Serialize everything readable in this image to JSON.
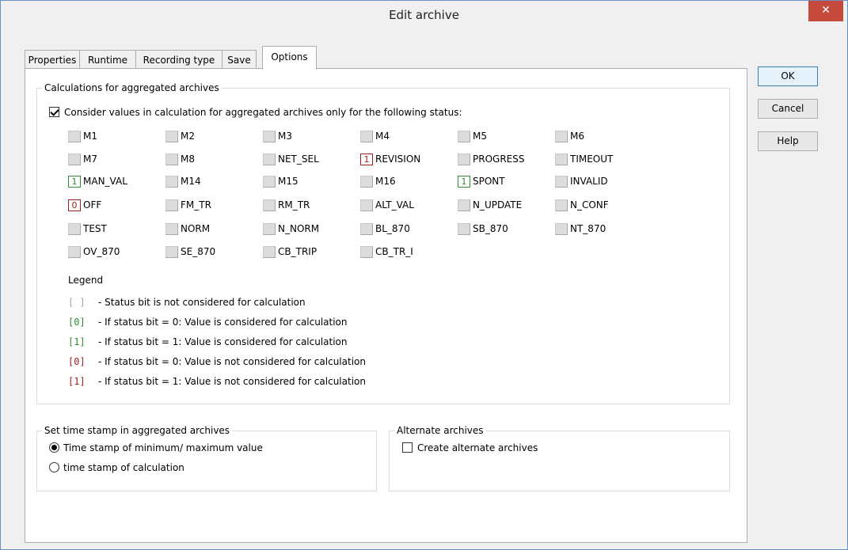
{
  "window": {
    "title": "Edit archive",
    "close_glyph": "✕"
  },
  "tabs": [
    {
      "label": "Properties"
    },
    {
      "label": "Runtime"
    },
    {
      "label": "Recording type"
    },
    {
      "label": "Save"
    },
    {
      "label": "Options",
      "active": true
    }
  ],
  "buttons": {
    "ok": "OK",
    "cancel": "Cancel",
    "help": "Help"
  },
  "calc_group": {
    "title": "Calculations for aggregated archives",
    "consider_checkbox": {
      "label": "Consider values in calculation for aggregated archives only for the following status:",
      "checked": true
    }
  },
  "statuses": [
    {
      "label": "M1",
      "state": "none",
      "value": ""
    },
    {
      "label": "M2",
      "state": "none",
      "value": ""
    },
    {
      "label": "M3",
      "state": "none",
      "value": ""
    },
    {
      "label": "M4",
      "state": "none",
      "value": ""
    },
    {
      "label": "M5",
      "state": "none",
      "value": ""
    },
    {
      "label": "M6",
      "state": "none",
      "value": ""
    },
    {
      "label": "M7",
      "state": "none",
      "value": ""
    },
    {
      "label": "M8",
      "state": "none",
      "value": ""
    },
    {
      "label": "NET_SEL",
      "state": "none",
      "value": ""
    },
    {
      "label": "REVISION",
      "state": "red",
      "value": "1"
    },
    {
      "label": "PROGRESS",
      "state": "none",
      "value": ""
    },
    {
      "label": "TIMEOUT",
      "state": "none",
      "value": ""
    },
    {
      "label": "MAN_VAL",
      "state": "green",
      "value": "1"
    },
    {
      "label": "M14",
      "state": "none",
      "value": ""
    },
    {
      "label": "M15",
      "state": "none",
      "value": ""
    },
    {
      "label": "M16",
      "state": "none",
      "value": ""
    },
    {
      "label": "SPONT",
      "state": "green",
      "value": "1"
    },
    {
      "label": "INVALID",
      "state": "none",
      "value": ""
    },
    {
      "label": "OFF",
      "state": "red",
      "value": "0"
    },
    {
      "label": "FM_TR",
      "state": "none",
      "value": ""
    },
    {
      "label": "RM_TR",
      "state": "none",
      "value": ""
    },
    {
      "label": "ALT_VAL",
      "state": "none",
      "value": ""
    },
    {
      "label": "N_UPDATE",
      "state": "none",
      "value": ""
    },
    {
      "label": "N_CONF",
      "state": "none",
      "value": ""
    },
    {
      "label": "TEST",
      "state": "none",
      "value": ""
    },
    {
      "label": "NORM",
      "state": "none",
      "value": ""
    },
    {
      "label": "N_NORM",
      "state": "none",
      "value": ""
    },
    {
      "label": "BL_870",
      "state": "none",
      "value": ""
    },
    {
      "label": "SB_870",
      "state": "none",
      "value": ""
    },
    {
      "label": "NT_870",
      "state": "none",
      "value": ""
    },
    {
      "label": "OV_870",
      "state": "none",
      "value": ""
    },
    {
      "label": "SE_870",
      "state": "none",
      "value": ""
    },
    {
      "label": "CB_TRIP",
      "state": "none",
      "value": ""
    },
    {
      "label": "CB_TR_I",
      "state": "none",
      "value": ""
    }
  ],
  "legend": {
    "title": "Legend",
    "rows": [
      {
        "symbol": "[ ]",
        "color": "#a0a0a0",
        "text": "- Status bit is not considered for calculation"
      },
      {
        "symbol": "[0]",
        "color": "#2e8b2e",
        "text": "- If status bit = 0: Value is considered for calculation"
      },
      {
        "symbol": "[1]",
        "color": "#2e8b2e",
        "text": "- If status bit = 1: Value is considered for calculation"
      },
      {
        "symbol": "[0]",
        "color": "#a02020",
        "text": "- If status bit = 0: Value is not considered for calculation"
      },
      {
        "symbol": "[1]",
        "color": "#a02020",
        "text": "- If status bit = 1: Value is not considered for calculation"
      }
    ]
  },
  "timestamp_group": {
    "title": "Set time stamp in aggregated archives",
    "options": [
      {
        "label": "Time stamp of minimum/ maximum value",
        "selected": true
      },
      {
        "label": "time stamp of calculation",
        "selected": false
      }
    ]
  },
  "alternate_group": {
    "title": "Alternate archives",
    "checkbox": {
      "label": "Create alternate archives",
      "checked": false
    }
  },
  "colors": {
    "green": "#2e8b2e",
    "red": "#a02020",
    "close": "#c74b3c",
    "border": "#6d8fc0"
  }
}
